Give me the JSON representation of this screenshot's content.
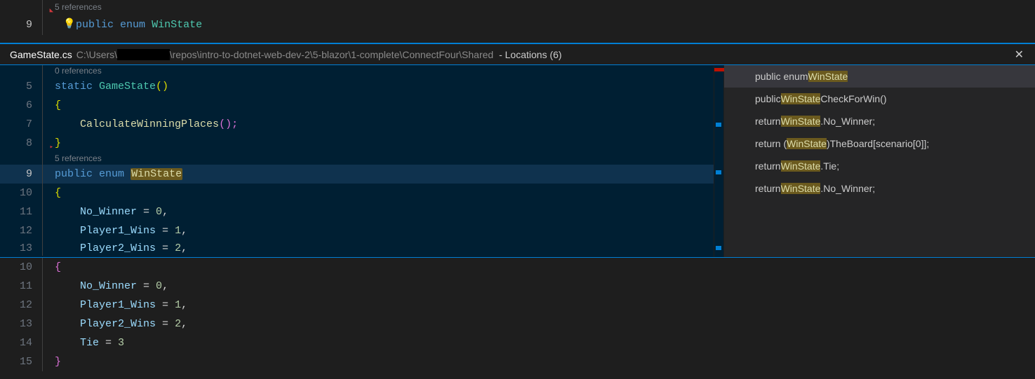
{
  "top": {
    "codelens": "5 references",
    "line_no": "9",
    "code_kw_public": "public",
    "code_kw_enum": "enum",
    "code_type": "WinState"
  },
  "peek": {
    "filename": "GameState.cs",
    "path": "C:\\Users\\",
    "path2": "\\repos\\intro-to-dotnet-web-dev-2\\5-blazor\\1-complete\\ConnectFour\\Shared",
    "locations": " - Locations (6)",
    "codelens": "0 references",
    "codelens2": "5 references",
    "lines": {
      "l5": {
        "n": "5",
        "kw": "static",
        "type": "GameState",
        "paren": "()"
      },
      "l6": {
        "n": "6",
        "br": "{"
      },
      "l7": {
        "n": "7",
        "id": "CalculateWinningPlaces",
        "paren": "();"
      },
      "l8": {
        "n": "8",
        "br": "}"
      },
      "l9": {
        "n": "9",
        "kw1": "public",
        "kw2": "enum",
        "type": "WinState"
      },
      "l10": {
        "n": "10",
        "br": "{"
      },
      "l11": {
        "n": "11",
        "mem": "No_Winner",
        "eq": " = ",
        "val": "0",
        "c": ","
      },
      "l12": {
        "n": "12",
        "mem": "Player1_Wins",
        "eq": " = ",
        "val": "1",
        "c": ","
      },
      "l13": {
        "n": "13",
        "mem": "Player2_Wins",
        "eq": " = ",
        "val": "2",
        "c": ","
      }
    }
  },
  "refs": [
    {
      "pre": "public enum ",
      "hl": "WinState",
      "post": ""
    },
    {
      "pre": "public ",
      "hl": "WinState",
      "post": " CheckForWin()"
    },
    {
      "pre": "return ",
      "hl": "WinState",
      "post": ".No_Winner;"
    },
    {
      "pre": "return (",
      "hl": "WinState",
      "post": ")TheBoard[scenario[0]];"
    },
    {
      "pre": "return ",
      "hl": "WinState",
      "post": ".Tie;"
    },
    {
      "pre": "return ",
      "hl": "WinState",
      "post": ".No_Winner;"
    }
  ],
  "bottom": {
    "lines": {
      "l10": {
        "n": "10",
        "br": "{"
      },
      "l11": {
        "n": "11",
        "mem": "No_Winner",
        "eq": " = ",
        "val": "0",
        "c": ","
      },
      "l12": {
        "n": "12",
        "mem": "Player1_Wins",
        "eq": " = ",
        "val": "1",
        "c": ","
      },
      "l13": {
        "n": "13",
        "mem": "Player2_Wins",
        "eq": " = ",
        "val": "2",
        "c": ","
      },
      "l14": {
        "n": "14",
        "mem": "Tie",
        "eq": " = ",
        "val": "3",
        "c": ""
      },
      "l15": {
        "n": "15",
        "br": "}"
      }
    }
  }
}
